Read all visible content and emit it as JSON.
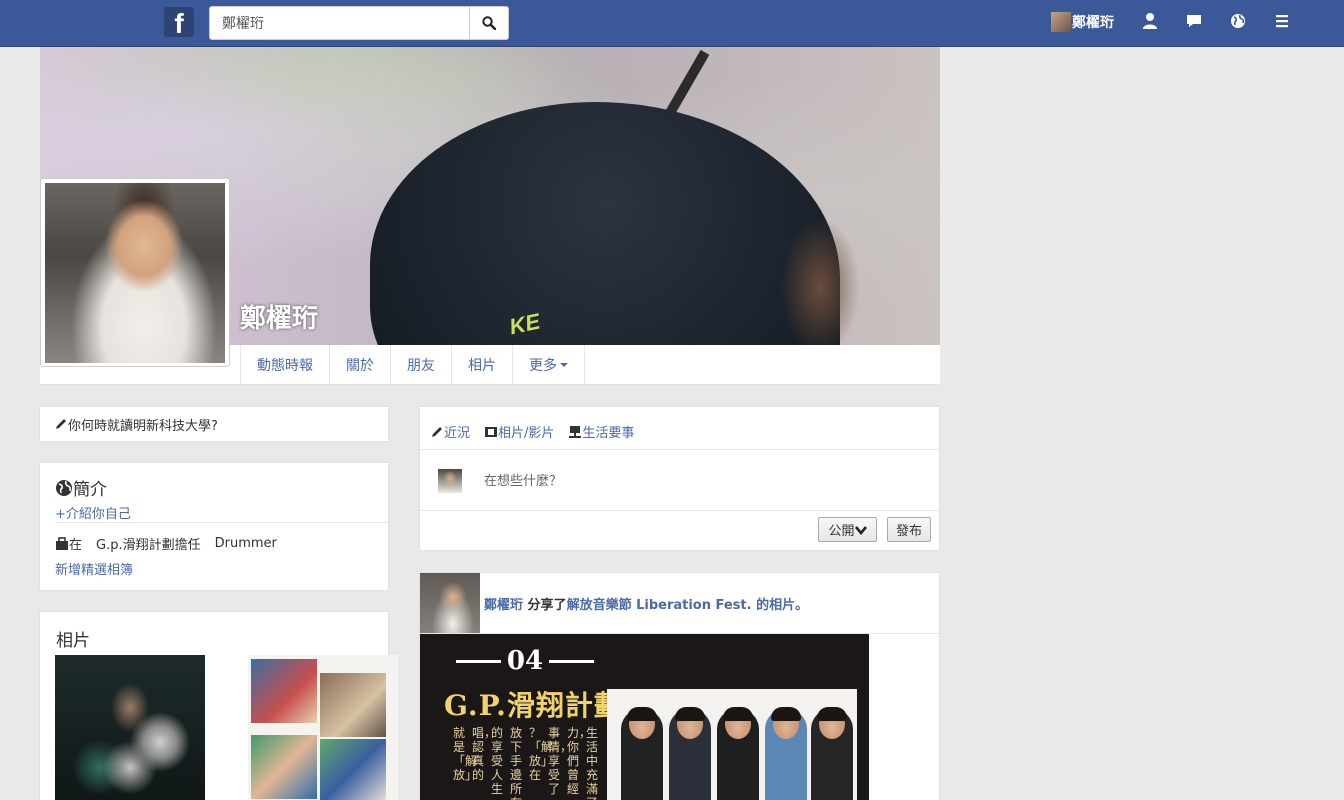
{
  "topbar": {
    "logo": "f",
    "search_value": "鄭櫂珩",
    "user_name": "鄭櫂珩",
    "icons": [
      "friend-requests-icon",
      "messages-icon",
      "notifications-globe-icon",
      "menu-icon"
    ]
  },
  "profile": {
    "name": "鄭櫂珩",
    "cover_text": "KE"
  },
  "nav": {
    "items": [
      "動態時報",
      "關於",
      "朋友",
      "相片"
    ],
    "more_label": "更多"
  },
  "left": {
    "question": "你何時就讀明新科技大學?",
    "intro": {
      "title": "簡介",
      "add_label": "+介紹你自己",
      "work_prefix": "在",
      "work_org": "G.p.滑翔計劃擔任",
      "work_role": "Drummer",
      "featured_label": "新增精選相簿"
    },
    "photos": {
      "title": "相片"
    }
  },
  "composer": {
    "tabs": [
      "近況",
      "相片/影片",
      "生活要事"
    ],
    "placeholder": "在想些什麼？",
    "privacy_label": "公開",
    "publish_label": "發布"
  },
  "post": {
    "author": "鄭櫂珩",
    "action": "分享了",
    "page_name": "解放音樂節 Liberation Fest.",
    "object": "的相片。",
    "image": {
      "number": "04",
      "title": "G.P.滑翔計劃",
      "columns": [
        "生活中充滿了",
        "力，你們曾經",
        "事情，享受了",
        "？「解放」在",
        "放下手邊所有",
        "的享受人生",
        "唱，認真的",
        "就是「解放」"
      ]
    }
  },
  "colors": {
    "topbar": "#3b5998",
    "link": "#4b6aa8",
    "page_bg": "#e9e9e9",
    "poster_title": "#f0d36b"
  }
}
